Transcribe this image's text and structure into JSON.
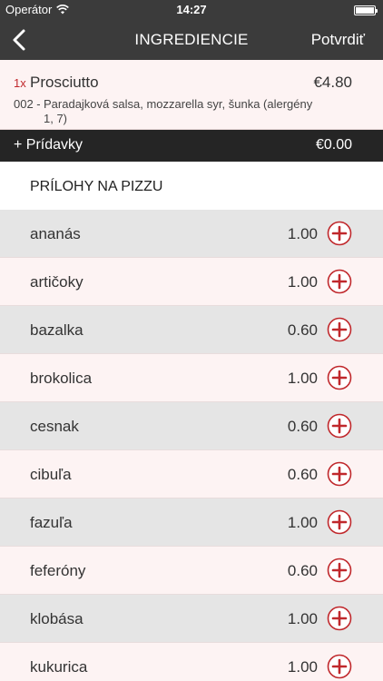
{
  "status_bar": {
    "carrier": "Operátor",
    "time": "14:27"
  },
  "nav": {
    "title": "INGREDIENCIE",
    "confirm": "Potvrdiť"
  },
  "item": {
    "qty": "1x",
    "name": "Prosciutto",
    "price": "€4.80",
    "code": "002 -",
    "description": "Paradajková salsa, mozzarella syr, šunka (alergény 1, 7)"
  },
  "extras": {
    "label": "+ Prídavky",
    "price": "€0.00"
  },
  "section": {
    "title": "PRÍLOHY NA PIZZU"
  },
  "colors": {
    "accent": "#c0282c",
    "nav_bg": "#3b3b3b",
    "extras_bg": "#252525",
    "row_gray": "#e5e5e5",
    "row_pink": "#fdf3f3"
  },
  "icons": {
    "back": "chevron-left-icon",
    "wifi": "wifi-icon",
    "battery": "battery-icon",
    "add": "plus-circle-icon"
  },
  "toppings": [
    {
      "name": "ananás",
      "price": "1.00"
    },
    {
      "name": "artičoky",
      "price": "1.00"
    },
    {
      "name": "bazalka",
      "price": "0.60"
    },
    {
      "name": "brokolica",
      "price": "1.00"
    },
    {
      "name": "cesnak",
      "price": "0.60"
    },
    {
      "name": "cibuľa",
      "price": "0.60"
    },
    {
      "name": "fazuľa",
      "price": "1.00"
    },
    {
      "name": "feferóny",
      "price": "0.60"
    },
    {
      "name": "klobása",
      "price": "1.00"
    },
    {
      "name": "kukurica",
      "price": "1.00"
    }
  ]
}
